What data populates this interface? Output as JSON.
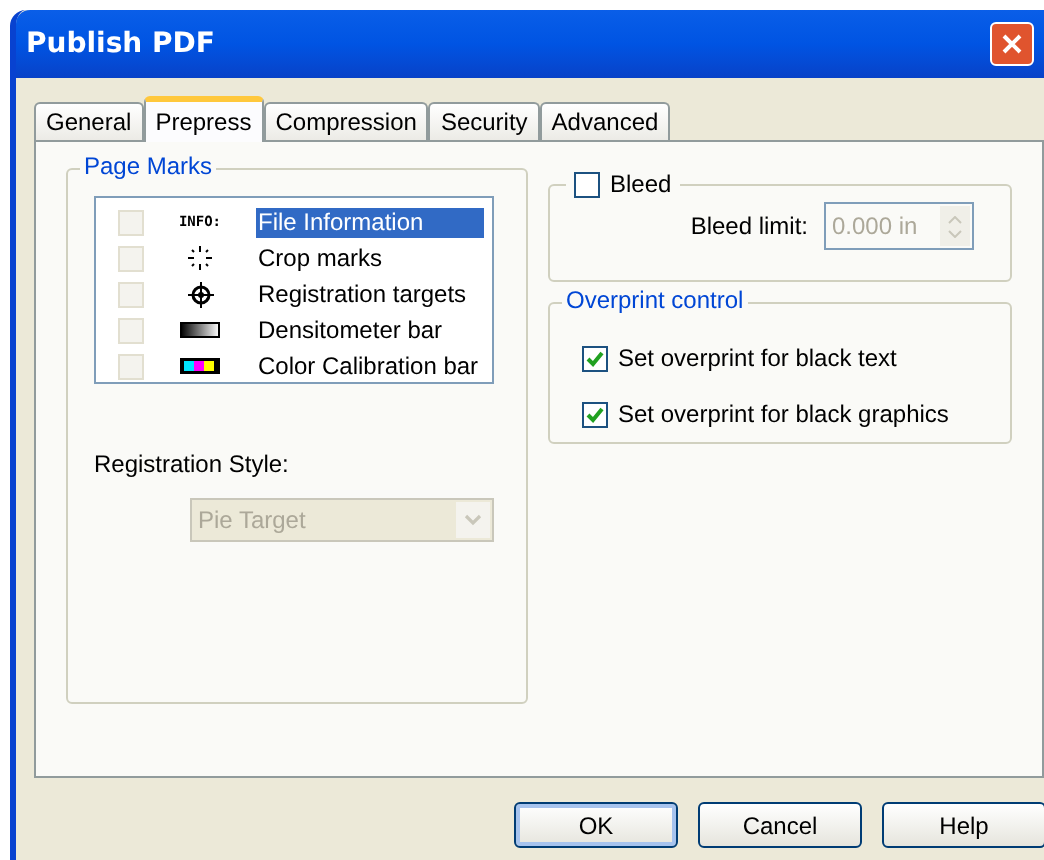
{
  "window": {
    "title": "Publish PDF"
  },
  "tabs": [
    {
      "label": "General",
      "selected": false
    },
    {
      "label": "Prepress",
      "selected": true
    },
    {
      "label": "Compression",
      "selected": false
    },
    {
      "label": "Security",
      "selected": false
    },
    {
      "label": "Advanced",
      "selected": false
    }
  ],
  "page_marks": {
    "title": "Page Marks",
    "items": [
      {
        "kind": "info",
        "icon_text": "INFO:",
        "label": "File Information",
        "checked": false,
        "selected": true
      },
      {
        "kind": "crop",
        "label": "Crop marks",
        "checked": false,
        "selected": false
      },
      {
        "kind": "target",
        "label": "Registration targets",
        "checked": false,
        "selected": false
      },
      {
        "kind": "densitometer",
        "label": "Densitometer bar",
        "checked": false,
        "selected": false
      },
      {
        "kind": "calibration",
        "label": "Color Calibration bar",
        "checked": false,
        "selected": false
      }
    ],
    "registration_style": {
      "label": "Registration Style:",
      "value": "Pie Target",
      "disabled": true
    }
  },
  "bleed": {
    "label": "Bleed",
    "checked": false,
    "limit_label": "Bleed limit:",
    "limit_value": "0.000 in",
    "disabled": true
  },
  "overprint": {
    "title": "Overprint control",
    "items": [
      {
        "label": "Set overprint for black text",
        "checked": true
      },
      {
        "label": "Set overprint for black graphics",
        "checked": true
      }
    ]
  },
  "buttons": [
    {
      "label": "OK",
      "default": true
    },
    {
      "label": "Cancel",
      "default": false
    },
    {
      "label": "Help",
      "default": false
    }
  ]
}
